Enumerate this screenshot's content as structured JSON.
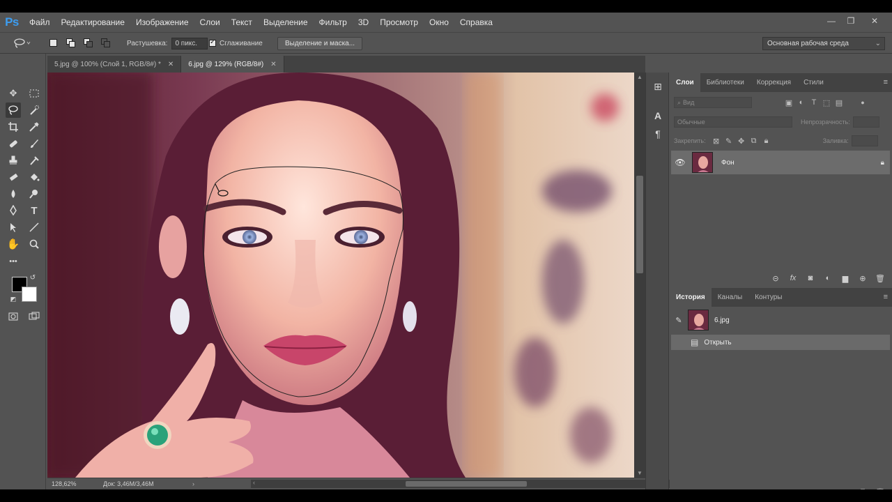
{
  "app": {
    "logo": "Ps"
  },
  "menu": [
    "Файл",
    "Редактирование",
    "Изображение",
    "Слои",
    "Текст",
    "Выделение",
    "Фильтр",
    "3D",
    "Просмотр",
    "Окно",
    "Справка"
  ],
  "window_controls": {
    "minimize": "—",
    "restore": "❐",
    "close": "✕"
  },
  "options": {
    "feather_label": "Растушевка:",
    "feather_value": "0 пикс.",
    "antialias_label": "Сглаживание",
    "antialias_checked": true,
    "select_mask_button": "Выделение и маска...",
    "workspace": "Основная рабочая среда"
  },
  "tabs": [
    {
      "title": "5.jpg @ 100% (Слой 1, RGB/8#) *",
      "close": "✕",
      "active": false
    },
    {
      "title": "6.jpg @ 129% (RGB/8#)",
      "close": "✕",
      "active": true
    }
  ],
  "status": {
    "zoom": "128,62%",
    "doc": "Док: 3,46M/3,46M"
  },
  "layers_panel": {
    "tabs": [
      "Слои",
      "Библиотеки",
      "Коррекция",
      "Стили"
    ],
    "kind_placeholder": "Вид",
    "blend_mode": "Обычные",
    "opacity_label": "Непрозрачность:",
    "lock_label": "Закрепить:",
    "fill_label": "Заливка:",
    "layers": [
      {
        "name": "Фон",
        "locked": true
      }
    ]
  },
  "history_panel": {
    "tabs": [
      "История",
      "Каналы",
      "Контуры"
    ],
    "snapshot": "6.jpg",
    "states": [
      "Открыть"
    ]
  },
  "colors": {
    "foreground": "#000000",
    "background": "#ffffff",
    "accent": "#3d9df0"
  }
}
